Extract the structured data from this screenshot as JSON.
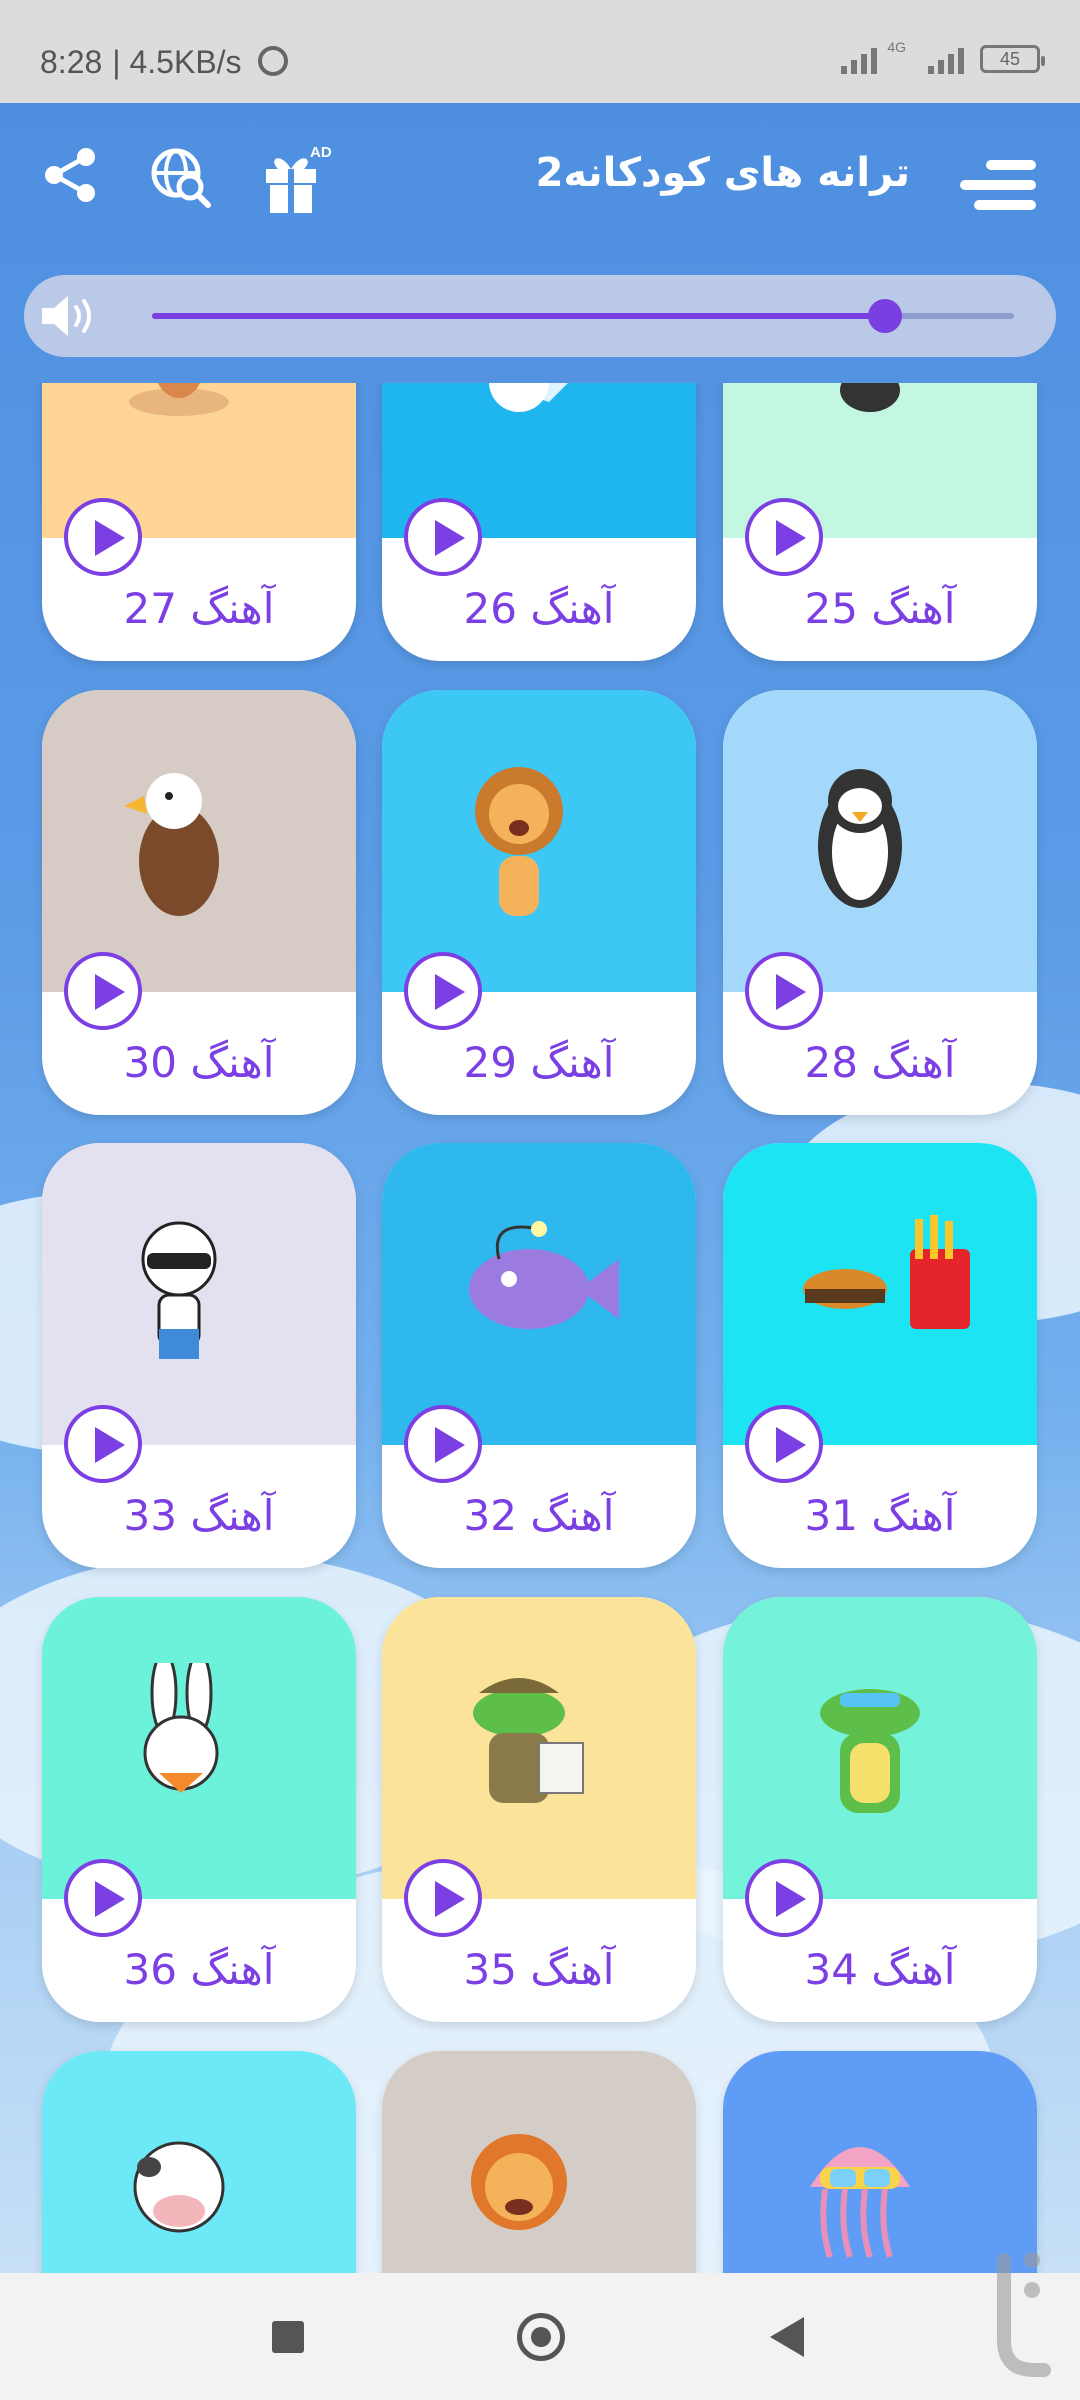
{
  "status_bar": {
    "time": "8:28",
    "speed": "| 4.5KB/s",
    "network": "4G",
    "battery": "45"
  },
  "header": {
    "title": "ترانه های کودکانه2",
    "ad_badge": "AD"
  },
  "volume": {
    "level": 0.85
  },
  "colors": {
    "accent": "#7b3fe4",
    "header_bg": "#4f8fe0"
  },
  "cards": [
    {
      "label": "آهنگ 27",
      "bg": "#ffd596",
      "animal": "squirrel"
    },
    {
      "label": "آهنگ 26",
      "bg": "#1fb6f0",
      "animal": "polar-bear-surf"
    },
    {
      "label": "آهنگ 25",
      "bg": "#c3f7e2",
      "animal": "panda"
    },
    {
      "label": "آهنگ 30",
      "bg": "#d7ccc5",
      "animal": "eagle"
    },
    {
      "label": "آهنگ 29",
      "bg": "#3cc7f5",
      "animal": "lion"
    },
    {
      "label": "آهنگ 28",
      "bg": "#a4d8fb",
      "animal": "penguin"
    },
    {
      "label": "آهنگ 33",
      "bg": "#e3e0ef",
      "animal": "polar-bear-sunglasses"
    },
    {
      "label": "آهنگ 32",
      "bg": "#2fb8ee",
      "animal": "anglerfish"
    },
    {
      "label": "آهنگ 31",
      "bg": "#1de4f3",
      "animal": "burger-fries"
    },
    {
      "label": "آهنگ 36",
      "bg": "#6cf2da",
      "animal": "bunny"
    },
    {
      "label": "آهنگ 35",
      "bg": "#fbe49a",
      "animal": "crocodile-explorer"
    },
    {
      "label": "آهنگ 34",
      "bg": "#74f3da",
      "animal": "crocodile-drink"
    },
    {
      "label": "",
      "bg": "#6de8f6",
      "animal": "cow"
    },
    {
      "label": "",
      "bg": "#d4ccc7",
      "animal": "lion-cub"
    },
    {
      "label": "",
      "bg": "#5e9cf6",
      "animal": "jellyfish"
    }
  ]
}
